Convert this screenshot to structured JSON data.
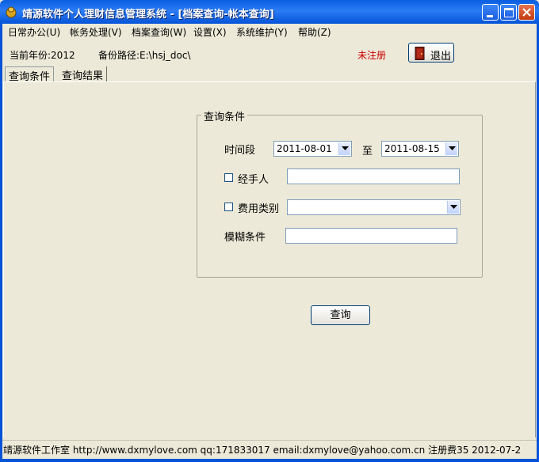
{
  "window": {
    "title": "靖源软件个人理财信息管理系统 - [档案查询-帐本查询]"
  },
  "menu": [
    {
      "label": "日常办公(U)"
    },
    {
      "label": "帐务处理(V)"
    },
    {
      "label": "档案查询(W)"
    },
    {
      "label": "设置(X)"
    },
    {
      "label": "系统维护(Y)"
    },
    {
      "label": "帮助(Z)"
    }
  ],
  "info": {
    "year": "当前年份:2012",
    "backup_path": "备份路径:E:\\hsj_doc\\",
    "reg_status": "未注册",
    "exit_label": "退出"
  },
  "tabs": [
    {
      "label": "查询条件",
      "active": true
    },
    {
      "label": "查询结果",
      "active": false
    }
  ],
  "form": {
    "group_title": "查询条件",
    "period_label": "时间段",
    "date_from": "2011-08-01",
    "to_label": "至",
    "date_to": "2011-08-15",
    "handler_label": "经手人",
    "handler_value": "",
    "expense_label": "费用类别",
    "expense_value": "",
    "fuzzy_label": "模糊条件",
    "fuzzy_value": "",
    "query_label": "查询"
  },
  "status": {
    "text": "靖源软件工作室 http://www.dxmylove.com qq:171833017 email:dxmylove@yahoo.com.cn 注册费35 2012-07-2"
  }
}
